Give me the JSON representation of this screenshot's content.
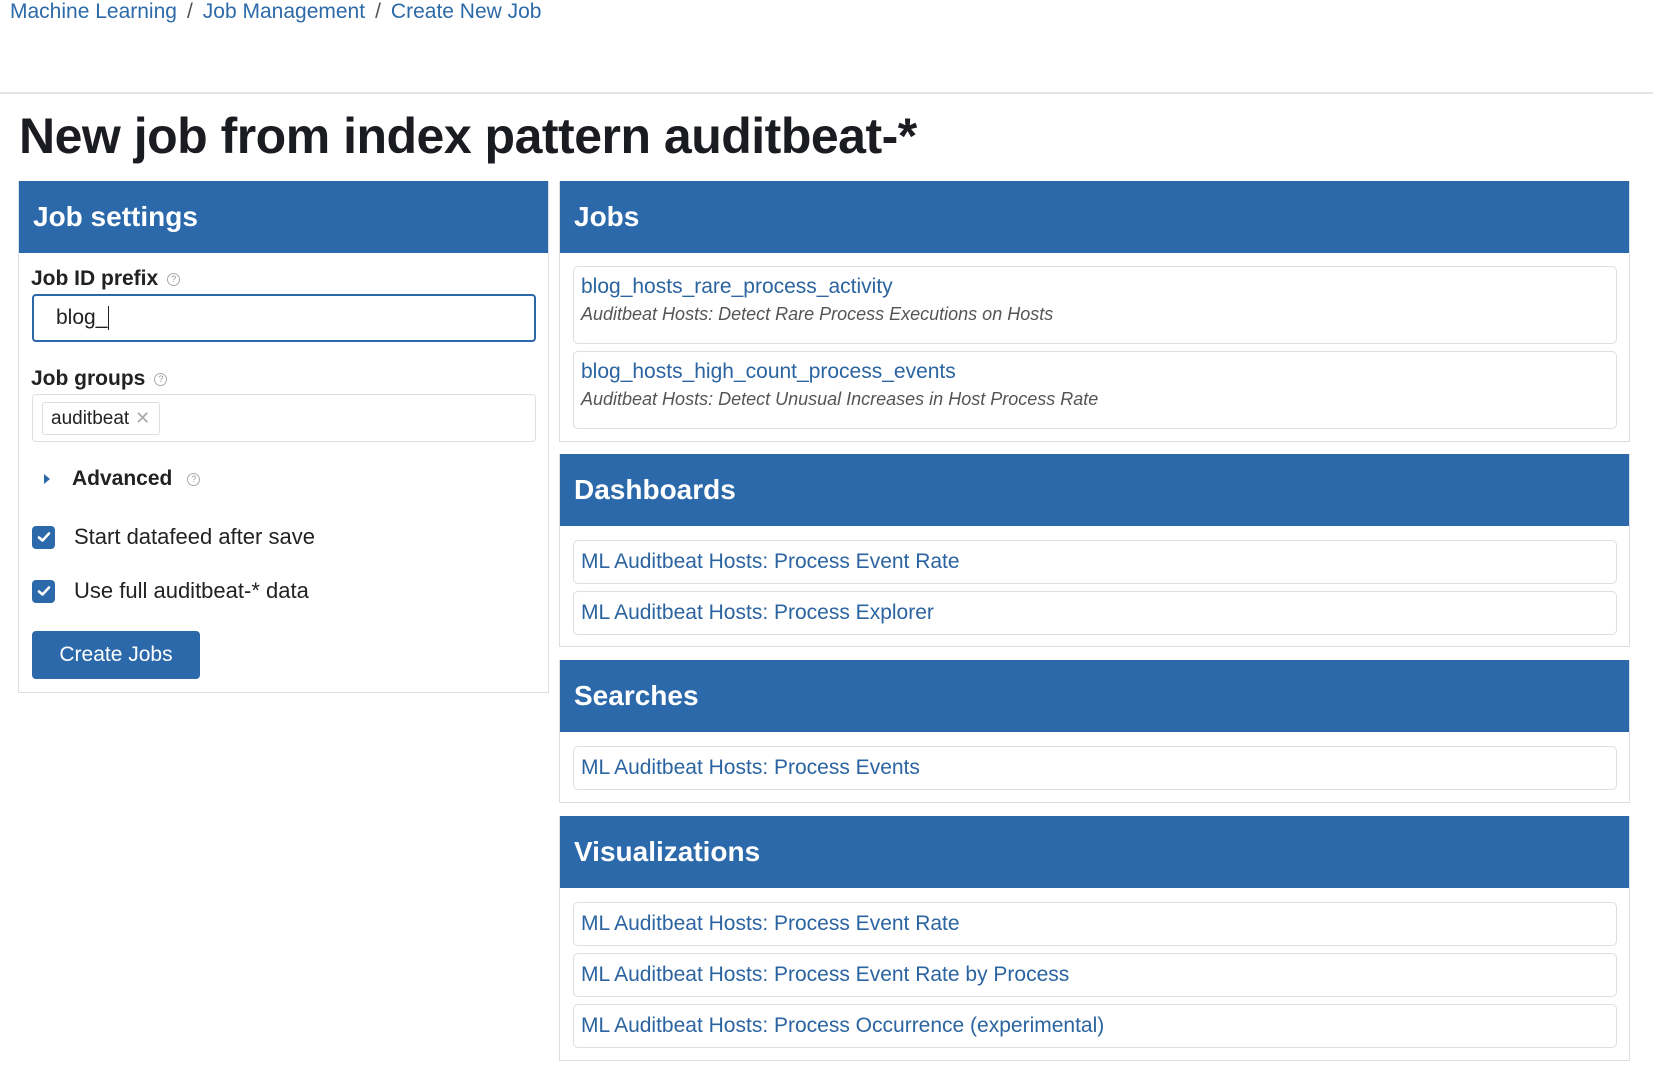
{
  "breadcrumbs": [
    "Machine Learning",
    "Job Management",
    "Create New Job"
  ],
  "breadcrumb_separator": "/",
  "page_title": "New job from index pattern auditbeat-*",
  "colors": {
    "primary": "#2b69ab",
    "link": "#2b64a0",
    "border": "#dcdee3"
  },
  "job_settings": {
    "header": "Job settings",
    "job_id_prefix": {
      "label": "Job ID prefix",
      "value": "blog_"
    },
    "job_groups": {
      "label": "Job groups",
      "chips": [
        "auditbeat"
      ]
    },
    "advanced_label": "Advanced",
    "checkboxes": [
      {
        "label": "Start datafeed after save",
        "checked": true
      },
      {
        "label": "Use full auditbeat-* data",
        "checked": true
      }
    ],
    "create_button": "Create Jobs"
  },
  "jobs": {
    "header": "Jobs",
    "items": [
      {
        "id": "blog_hosts_rare_process_activity",
        "description": "Auditbeat Hosts: Detect Rare Process Executions on Hosts"
      },
      {
        "id": "blog_hosts_high_count_process_events",
        "description": "Auditbeat Hosts: Detect Unusual Increases in Host Process Rate"
      }
    ]
  },
  "dashboards": {
    "header": "Dashboards",
    "items": [
      "ML Auditbeat Hosts: Process Event Rate",
      "ML Auditbeat Hosts: Process Explorer"
    ]
  },
  "searches": {
    "header": "Searches",
    "items": [
      "ML Auditbeat Hosts: Process Events"
    ]
  },
  "visualizations": {
    "header": "Visualizations",
    "items": [
      "ML Auditbeat Hosts: Process Event Rate",
      "ML Auditbeat Hosts: Process Event Rate by Process",
      "ML Auditbeat Hosts: Process Occurrence (experimental)"
    ]
  }
}
